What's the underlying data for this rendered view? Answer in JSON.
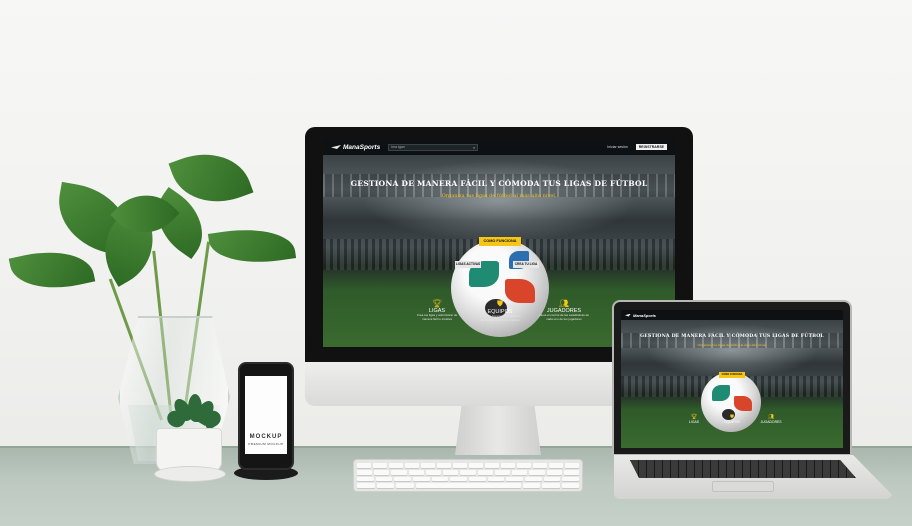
{
  "scene": {
    "phone_brand": "MOCKUP",
    "phone_brand_sub": "PREMIUM MOCKUP"
  },
  "site": {
    "logo": "ManaSports",
    "search_placeholder": "Ima tgan",
    "search_icon": "search-icon",
    "nav_login": "Iniciar sesión",
    "nav_register": "REGISTRARSE",
    "hero_title": "GESTIONA DE MANERA FÁCIL Y CÓMODA TUS LIGAS DE FÚTBOL",
    "hero_subtitle": "Organiza tus ligas de fútbol al más alto nivel.",
    "buttons": {
      "how_it_works": "COMO FUNCIONA",
      "active_leagues": "LIGAS ACTIVAS",
      "create_league": "CREA TU LIGA"
    },
    "features": [
      {
        "icon": "trophy-icon",
        "title": "LIGAS",
        "desc": "Crea tus ligas y administrar de manera fácil e intuitiva"
      },
      {
        "icon": "shield-icon",
        "title": "EQUIPOS",
        "desc": "Gestiona horarios, resultados y clasificaciones de tus equipos"
      },
      {
        "icon": "players-icon",
        "title": "JUGADORES",
        "desc": "Lleva el control de las estadísticas de cada uno de tus jugadores"
      }
    ],
    "accent_color": "#f5c518"
  }
}
